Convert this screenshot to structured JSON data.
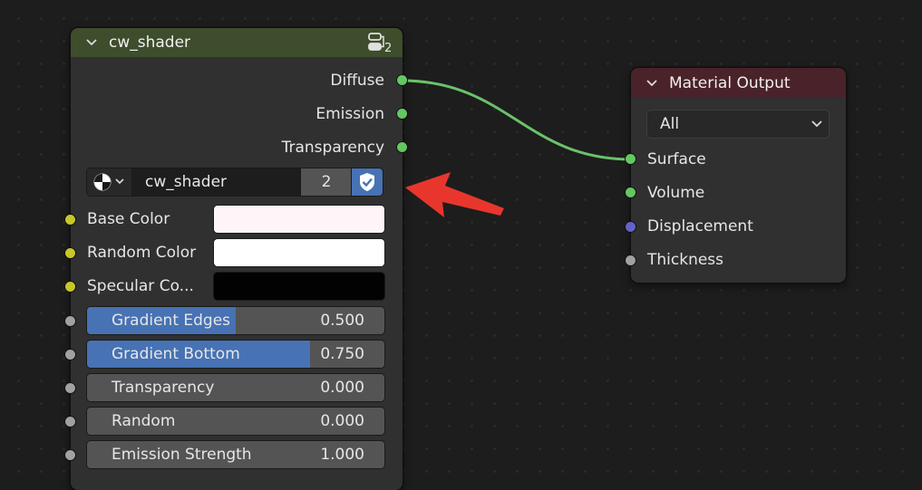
{
  "group_node": {
    "title": "cw_shader",
    "user_count": "2",
    "outputs": [
      "Diffuse",
      "Emission",
      "Transparency"
    ],
    "datablock": {
      "name": "cw_shader",
      "users": "2"
    },
    "color_inputs": [
      {
        "label": "Base Color",
        "color": "#fdf5f8"
      },
      {
        "label": "Random Color",
        "color": "#ffffff"
      },
      {
        "label": "Specular Co...",
        "color": "#020202"
      }
    ],
    "value_inputs": [
      {
        "label": "Gradient Edges",
        "value": "0.500",
        "fraction": 0.5
      },
      {
        "label": "Gradient Bottom",
        "value": "0.750",
        "fraction": 0.75
      },
      {
        "label": "Transparency",
        "value": "0.000",
        "fraction": 0
      },
      {
        "label": "Random",
        "value": "0.000",
        "fraction": 0
      },
      {
        "label": "Emission Strength",
        "value": "1.000",
        "fraction": 0
      }
    ]
  },
  "output_node": {
    "title": "Material Output",
    "target": "All",
    "inputs": [
      "Surface",
      "Volume",
      "Displacement",
      "Thickness"
    ]
  },
  "colors": {
    "group_header": "#3e4d2c",
    "output_header": "#4a2229",
    "accent": "#4772b3",
    "shader_socket": "#63c763",
    "color_socket": "#c7c729",
    "float_socket": "#a1a1a1",
    "vector_socket": "#6363c7",
    "link": "#6bc26b",
    "annotation_arrow": "#e8362d"
  },
  "icons": {
    "collapse": "chevron-down-icon",
    "node_tree": "node-tree-icon",
    "material": "material-sphere-icon",
    "fake_user": "shield-check-icon",
    "dropdown": "chevron-down-icon"
  }
}
